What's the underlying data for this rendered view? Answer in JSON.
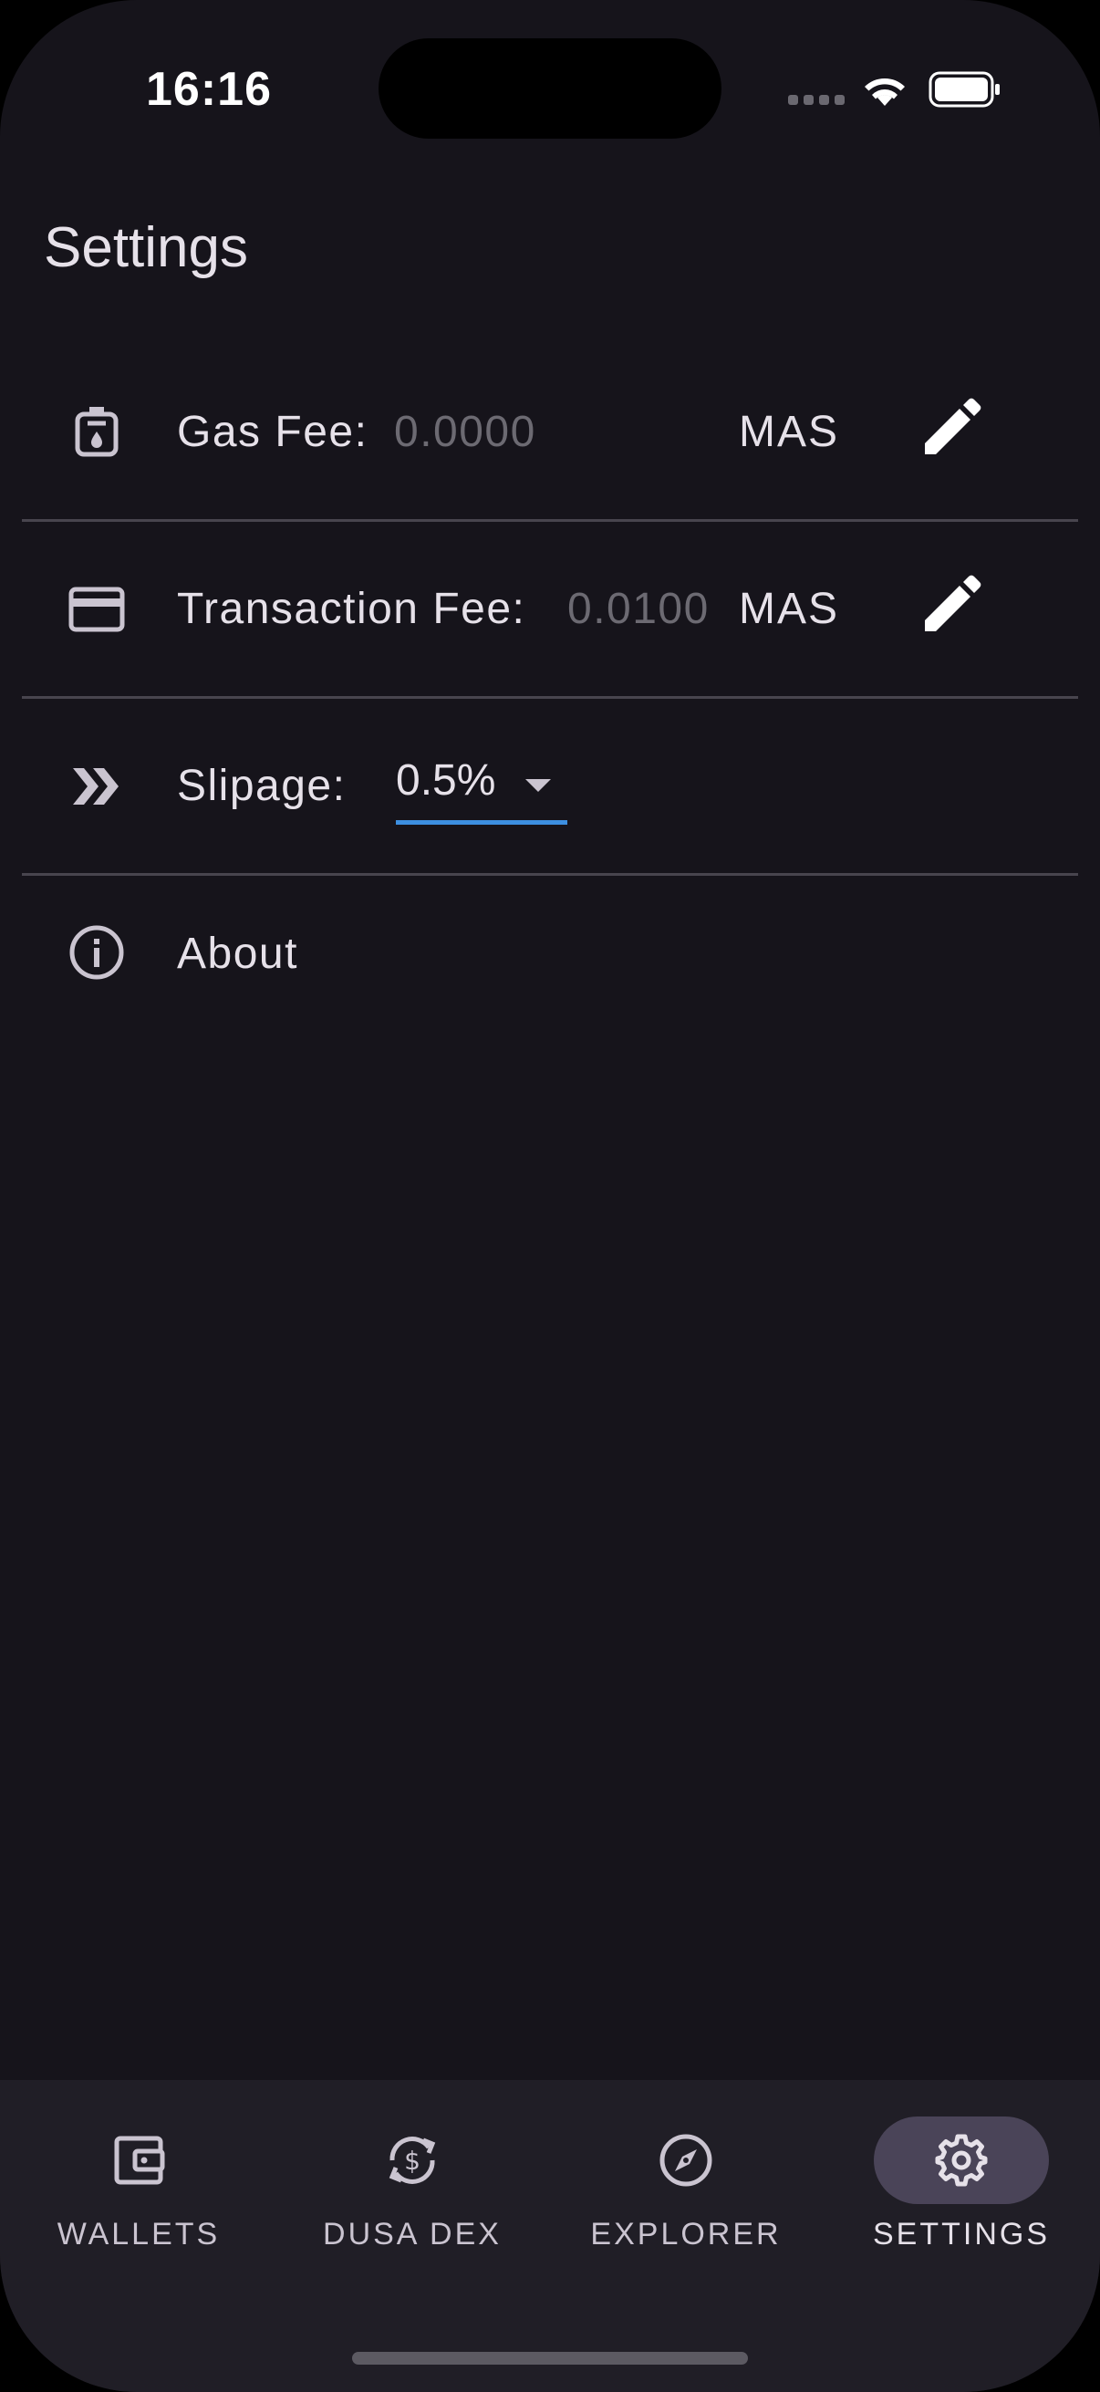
{
  "status_bar": {
    "time": "16:16"
  },
  "header": {
    "title": "Settings"
  },
  "settings": {
    "gas_fee": {
      "label": "Gas Fee:",
      "value": "0.0000",
      "unit": "MAS",
      "icon": "gas-pump-icon",
      "edit_icon": "pencil-icon"
    },
    "transaction_fee": {
      "label": "Transaction Fee:",
      "value": "0.0100",
      "unit": "MAS",
      "icon": "credit-card-icon",
      "edit_icon": "pencil-icon"
    },
    "slippage": {
      "label": "Slipage:",
      "selected": "0.5%",
      "icon": "double-chevron-right-icon"
    },
    "about": {
      "label": "About",
      "icon": "info-icon"
    }
  },
  "bottom_nav": {
    "items": [
      {
        "label": "WALLETS",
        "icon": "wallet-icon",
        "active": false
      },
      {
        "label": "DUSA DEX",
        "icon": "currency-exchange-icon",
        "active": false
      },
      {
        "label": "EXPLORER",
        "icon": "compass-icon",
        "active": false
      },
      {
        "label": "SETTINGS",
        "icon": "gear-icon",
        "active": true
      }
    ]
  },
  "colors": {
    "background": "#16141b",
    "nav_background": "#201e26",
    "active_pill": "#4a4458",
    "accent_underline": "#3d8fe0",
    "divider": "#48454e",
    "muted_text": "#6c6a72"
  }
}
